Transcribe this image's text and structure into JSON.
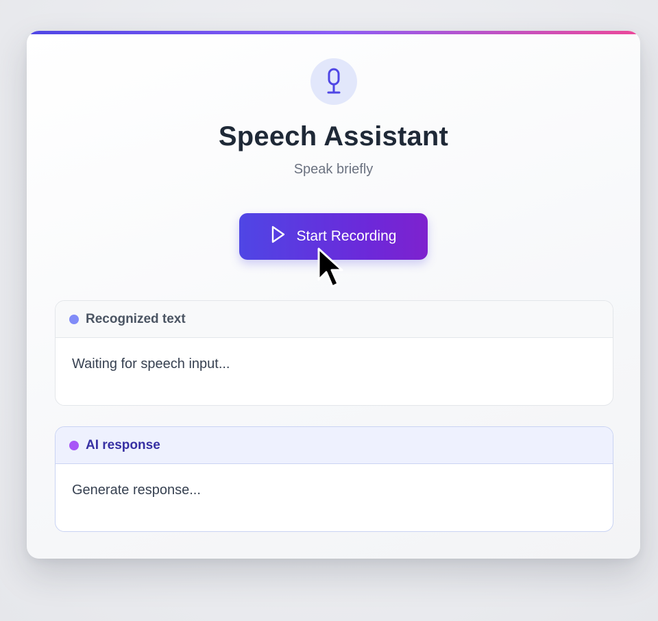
{
  "app": {
    "title": "Speech Assistant",
    "subtitle": "Speak briefly"
  },
  "colors": {
    "accent_start": "#4f46e5",
    "accent_mid": "#8b5cf6",
    "accent_end": "#ec4899",
    "recognized_dot": "#818cf8",
    "ai_dot": "#a855f7"
  },
  "icons": {
    "header": "microphone-icon",
    "record": "play-icon",
    "pointer": "mouse-cursor"
  },
  "record_button": {
    "label": "Start Recording"
  },
  "panels": {
    "recognized": {
      "header": "Recognized text",
      "body": "Waiting for speech input..."
    },
    "ai": {
      "header": "AI response",
      "body": "Generate response..."
    }
  }
}
